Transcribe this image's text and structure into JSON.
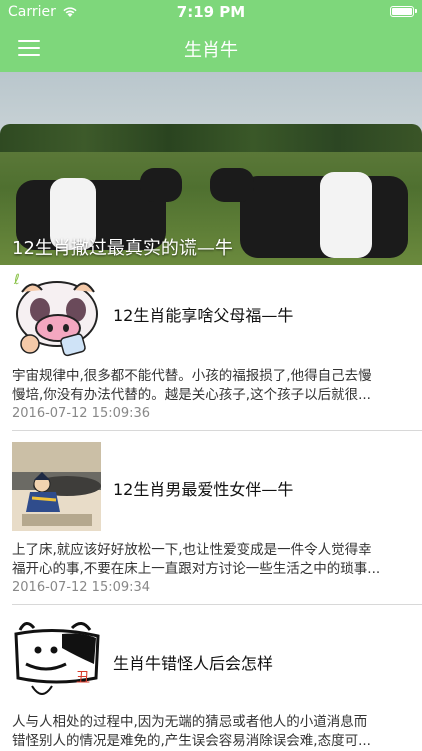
{
  "status_bar": {
    "carrier": "Carrier",
    "time": "7:19 PM"
  },
  "navbar": {
    "title": "生肖牛"
  },
  "hero": {
    "caption": "12生肖撒过最真实的谎—牛"
  },
  "articles": [
    {
      "title": "12生肖能享啥父母福—牛",
      "summary_line1": "宇宙规律中,很多都不能代替。小孩的福报损了,他得自己去慢",
      "summary_line2": "慢培,你没有办法代替的。越是关心孩子,这个孩子以后就很...",
      "date": "2016-07-12 15:09:36"
    },
    {
      "title": "12生肖男最爱性女伴—牛",
      "summary_line1": "上了床,就应该好好放松一下,也让性爱变成是一件令人觉得幸",
      "summary_line2": "福开心的事,不要在床上一直跟对方讨论一些生活之中的琐事...",
      "date": "2016-07-12 15:09:34"
    },
    {
      "title": "生肖牛错怪人后会怎样",
      "summary_line1": "人与人相处的过程中,因为无端的猜忌或者他人的小道消息而",
      "summary_line2": "错怪别人的情况是难免的,产生误会容易消除误会难,态度可..."
    }
  ]
}
